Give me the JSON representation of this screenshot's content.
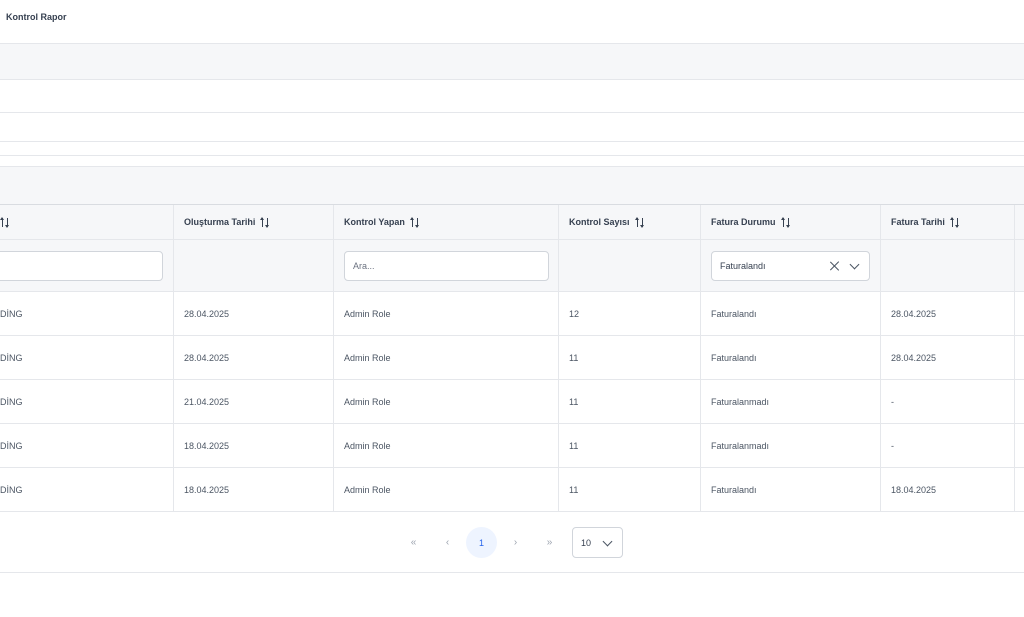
{
  "page": {
    "title": "Kontrol Rapor"
  },
  "table": {
    "columns": [
      {
        "label": ""
      },
      {
        "label": "Oluşturma Tarihi"
      },
      {
        "label": "Kontrol Yapan"
      },
      {
        "label": "Kontrol Sayısı"
      },
      {
        "label": "Fatura Durumu"
      },
      {
        "label": "Fatura Tarihi"
      }
    ],
    "filters": {
      "col0_value": "",
      "kontrol_yapan_placeholder": "Ara...",
      "fatura_durumu_selected": "Faturalandı"
    },
    "rows": [
      {
        "c0": "DİNG",
        "olusturma_tarihi": "28.04.2025",
        "kontrol_yapan": "Admin Role",
        "kontrol_sayisi": "12",
        "fatura_durumu": "Faturalandı",
        "fatura_tarihi": "28.04.2025"
      },
      {
        "c0": "DİNG",
        "olusturma_tarihi": "28.04.2025",
        "kontrol_yapan": "Admin Role",
        "kontrol_sayisi": "11",
        "fatura_durumu": "Faturalandı",
        "fatura_tarihi": "28.04.2025"
      },
      {
        "c0": "DİNG",
        "olusturma_tarihi": "21.04.2025",
        "kontrol_yapan": "Admin Role",
        "kontrol_sayisi": "11",
        "fatura_durumu": "Faturalanmadı",
        "fatura_tarihi": "-"
      },
      {
        "c0": "DİNG",
        "olusturma_tarihi": "18.04.2025",
        "kontrol_yapan": "Admin Role",
        "kontrol_sayisi": "11",
        "fatura_durumu": "Faturalanmadı",
        "fatura_tarihi": "-"
      },
      {
        "c0": "DİNG",
        "olusturma_tarihi": "18.04.2025",
        "kontrol_yapan": "Admin Role",
        "kontrol_sayisi": "11",
        "fatura_durumu": "Faturalandı",
        "fatura_tarihi": "18.04.2025"
      }
    ]
  },
  "pagination": {
    "first": "«",
    "prev": "‹",
    "current_page": "1",
    "next": "›",
    "last": "»",
    "rows_per_page": "10"
  },
  "colors": {
    "accent": "#2563eb",
    "active_page_bg": "#eef4ff",
    "header_bg": "#f6f7f9",
    "border": "#e5e7eb"
  }
}
